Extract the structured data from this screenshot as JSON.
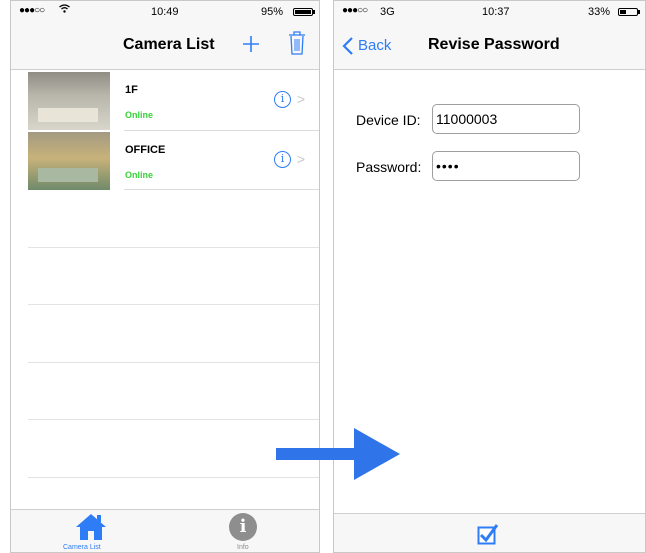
{
  "left_screen": {
    "status": {
      "time": "10:49",
      "battery": "95%",
      "battery_level": 0.95
    },
    "nav": {
      "title": "Camera List",
      "add_icon": "plus-icon",
      "delete_icon": "trash-icon"
    },
    "cameras": [
      {
        "name": "1F",
        "status": "Online",
        "status_color": "#39d23a"
      },
      {
        "name": "OFFICE",
        "status": "Online",
        "status_color": "#39d23a"
      }
    ],
    "tabs": [
      {
        "label": "Camera List",
        "icon": "house-icon",
        "active": true
      },
      {
        "label": "Info",
        "icon": "info-icon",
        "active": false
      }
    ]
  },
  "right_screen": {
    "status": {
      "carrier": "3G",
      "time": "10:37",
      "battery": "33%",
      "battery_level": 0.33
    },
    "nav": {
      "back_label": "Back",
      "title": "Revise Password"
    },
    "form": {
      "device_id_label": "Device ID:",
      "device_id_value": "11000003",
      "password_label": "Password:",
      "password_value": "••••"
    },
    "confirm_icon": "checkbox-checked-icon"
  },
  "colors": {
    "accent": "#2f7df6",
    "online": "#39d23a",
    "inactive_tab": "#8e8e8e"
  }
}
